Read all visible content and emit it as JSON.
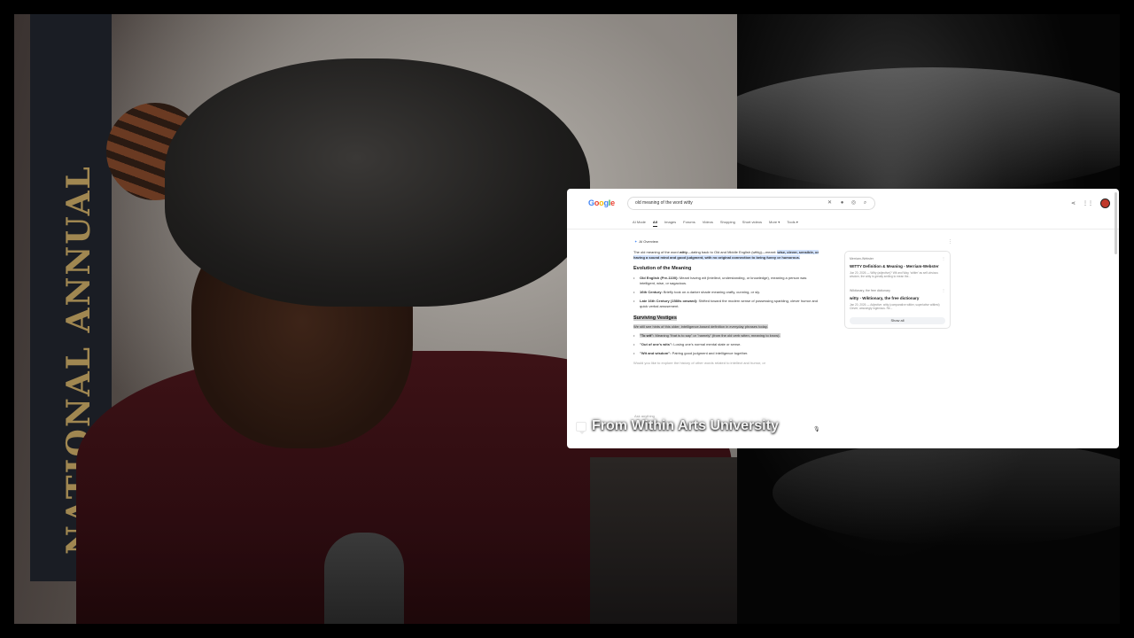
{
  "scene": {
    "banner_text": "NATIONAL ANNUAL"
  },
  "browser": {
    "search_query": "old meaning of the word witty",
    "tabs": [
      "AI Mode",
      "All",
      "Images",
      "Forums",
      "Videos",
      "Shopping",
      "Short videos",
      "More ▾",
      "Tools ▾"
    ],
    "active_tab": "All",
    "overview_label": "AI Overview",
    "intro_plain": "The old meaning of the word ",
    "intro_bold": "witty",
    "intro_rest": "—dating back to Old and Middle English (wittig)—meant: ",
    "intro_highlight": "wise, clever, sensible, or having a sound mind and good judgment, with no original connection to being funny or humorous.",
    "section1_title": "Evolution of the Meaning",
    "evolution": [
      {
        "label": "Old English (Pre-1100):",
        "text": " Meant having wit (intellect, understanding, or knowledge), meaning a person was intelligent, wise, or sagacious."
      },
      {
        "label": "16th Century:",
        "text": " Briefly took on a darker shade meaning crafty, cunning, or sly."
      },
      {
        "label": "Late 16th Century (1580s onward):",
        "text": " Shifted toward the modern sense of possessing sparkling, clever humor and quick verbal amusement."
      }
    ],
    "section2_title": "Surviving Vestiges",
    "vestiges_intro": "We still see hints of this older, intelligence-based definition in everyday phrases today.",
    "vestiges": [
      {
        "label": "\"To wit\":",
        "text": " Meaning \"that is to say\" or \"namely\" (from the old verb witen, meaning to know)."
      },
      {
        "label": "\"Out of one's wits\":",
        "text": " Losing one's normal mental state or sense."
      },
      {
        "label": "\"Wit and wisdom\":",
        "text": " Pairing good judgment and intelligence together."
      }
    ],
    "followup": "Would you like to explore the history of other words related to intellect and humor, or",
    "ask_placeholder": "Ask anything",
    "sources": [
      {
        "site": "Merriam-Webster",
        "title": "WITTY Definition & Meaning - Merriam-Webster",
        "desc": "Jun 20, 2026 — Witty (adjective)? Wit and Way, 'wittier' as self-obvious wisdom, the witty is greatly smiling to mean the..."
      },
      {
        "site": "Wiktionary, the free dictionary",
        "title": "witty - Wiktionary, the free dictionary",
        "desc": "Jan 20, 2026 — Adjective. witty (comparative wittier, superlative wittiest) Clever; amusingly ingenious. Re..."
      }
    ],
    "show_all": "Show all"
  },
  "caption": {
    "text": "From Within Arts University"
  }
}
